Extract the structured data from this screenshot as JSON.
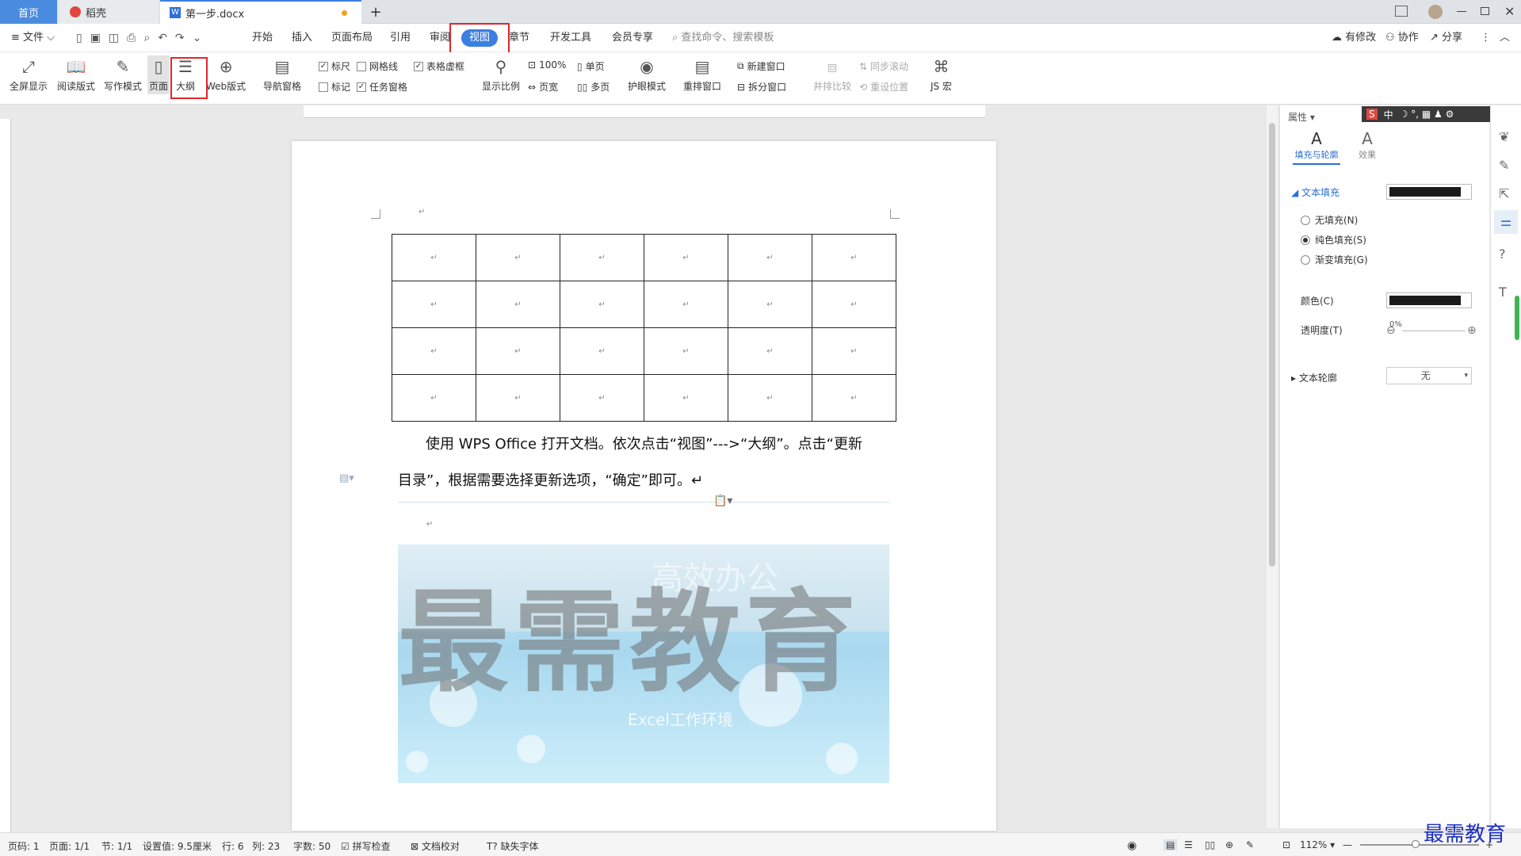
{
  "tabs": {
    "home": "首页",
    "daoke": "稻壳",
    "doc": "第一步.docx",
    "add": "+"
  },
  "menubar": {
    "file": "文件",
    "items": [
      "开始",
      "插入",
      "页面布局",
      "引用",
      "审阅",
      "视图",
      "章节",
      "开发工具",
      "会员专享"
    ],
    "search": "查找命令、搜索模板",
    "right": [
      "有修改",
      "协作",
      "分享"
    ]
  },
  "ribbon": {
    "fullscreen": "全屏显示",
    "reading": "阅读版式",
    "writing": "写作模式",
    "page": "页面",
    "outline": "大纲",
    "web": "Web版式",
    "nav": "导航窗格",
    "ruler": "标尺",
    "gridlines": "网格线",
    "tablegrid": "表格虚框",
    "mark": "标记",
    "taskpane": "任务窗格",
    "zoom": "显示比例",
    "hundred": "100%",
    "pagewidth": "页宽",
    "single": "单页",
    "multi": "多页",
    "eye": "护眼模式",
    "arrange": "重排窗口",
    "newwin": "新建窗口",
    "split": "拆分窗口",
    "compare": "并排比较",
    "sync": "同步滚动",
    "reset": "重设位置",
    "js": "JS 宏"
  },
  "document": {
    "table_rows": 4,
    "table_cols": 6,
    "cell_mark": "↵",
    "line1": "使用 WPS Office 打开文档。依次点击“视图”--->“大纲”。点击“更新",
    "line2": "目录”，根据需要选择更新选项，“确定”即可。↵",
    "pmark": "↵",
    "banner_title": "高效办公",
    "banner_sub": "Excel工作环境",
    "watermark": "最需教育"
  },
  "panel": {
    "properties": "属性",
    "tab_fill": "填充与轮廓",
    "tab_effect": "效果",
    "text_fill": "文本填充",
    "no_fill": "无填充(N)",
    "solid_fill": "纯色填充(S)",
    "gradient_fill": "渐变填充(G)",
    "color": "颜色(C)",
    "transparency": "透明度(T)",
    "transparency_value": "0%",
    "text_outline": "文本轮廓",
    "outline_value": "无",
    "ime": "中"
  },
  "status": {
    "page": "页码: 1",
    "pages": "页面: 1/1",
    "section": "节: 1/1",
    "setting": "设置值: 9.5厘米",
    "row": "行: 6",
    "col": "列: 23",
    "words": "字数: 50",
    "spell": "拼写检查",
    "proof": "文档校对",
    "missing_font": "缺失字体",
    "zoom": "112%"
  },
  "corner_watermark": "最需教育",
  "colors": {
    "accent": "#3d7fe0",
    "highlight": "#e0262c"
  }
}
